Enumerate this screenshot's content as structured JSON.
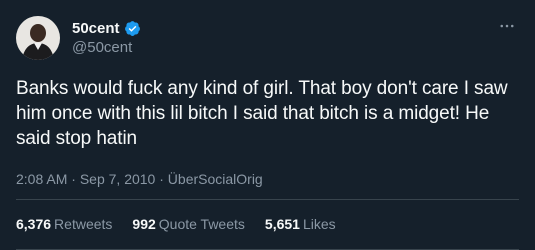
{
  "user": {
    "display_name": "50cent",
    "handle": "@50cent",
    "verified_icon": "verified-badge-icon"
  },
  "tweet": {
    "text": "Banks would fuck any kind of girl. That boy don't care I saw him once with this lil bitch I said that bitch is a midget! He said stop hatin"
  },
  "meta": {
    "time": "2:08 AM",
    "separator1": "·",
    "date": "Sep 7, 2010",
    "separator2": "·",
    "source": "ÜberSocialOrig"
  },
  "stats": {
    "retweets_count": "6,376",
    "retweets_label": "Retweets",
    "quotes_count": "992",
    "quotes_label": "Quote Tweets",
    "likes_count": "5,651",
    "likes_label": "Likes"
  },
  "colors": {
    "background": "#15202b",
    "text": "#f7f9f9",
    "secondary": "#8b98a5",
    "verified": "#1d9bf0",
    "divider": "#38444d"
  }
}
